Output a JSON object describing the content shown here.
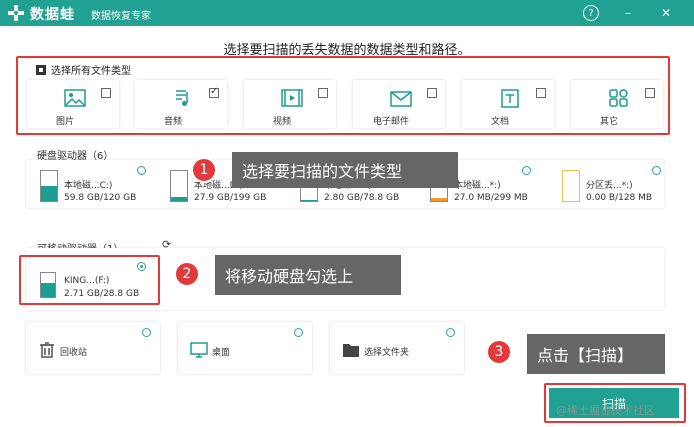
{
  "titlebar": {
    "app_name": "数据蛙",
    "subtitle": "数据恢复专家",
    "help": "?",
    "minimize": "–",
    "close": "✕"
  },
  "heading": "选择要扫描的丢失数据的数据类型和路径。",
  "file_types": {
    "select_all": "选择所有文件类型",
    "items": [
      {
        "label": "图片",
        "checked": false
      },
      {
        "label": "音频",
        "checked": true
      },
      {
        "label": "视频",
        "checked": false
      },
      {
        "label": "电子邮件",
        "checked": false
      },
      {
        "label": "文档",
        "checked": false
      },
      {
        "label": "其它",
        "checked": false
      }
    ]
  },
  "hard_drives": {
    "title": "硬盘驱动器（6）",
    "items": [
      {
        "name": "本地磁...C:)",
        "size": "59.8 GB/120 GB",
        "fill": 0.5
      },
      {
        "name": "本地磁...D:)",
        "size": "27.9 GB/199 GB",
        "fill": 0.14
      },
      {
        "name": "本地磁...E:)",
        "size": "2.80 GB/78.8 GB",
        "fill": 0.04
      },
      {
        "name": "本地磁...*:)",
        "size": "27.0 MB/299 MB",
        "fill": 0.09
      },
      {
        "name": "分区丢...*:)",
        "size": "0.00  B/128 MB",
        "fill": 0.0
      }
    ]
  },
  "removable": {
    "title": "可移动驱动器（1）",
    "drive": {
      "name": "KING...(F:)",
      "size": "2.71 GB/28.8 GB"
    }
  },
  "locations": [
    {
      "label": "回收站"
    },
    {
      "label": "桌面"
    },
    {
      "label": "选择文件夹"
    }
  ],
  "callouts": [
    {
      "num": "1",
      "text": "选择要扫描的文件类型"
    },
    {
      "num": "2",
      "text": "将移动硬盘勾选上"
    },
    {
      "num": "3",
      "text": "点击【扫描】"
    }
  ],
  "scan_button": "扫描",
  "watermark": "@稀土掘金技术社区",
  "colors": {
    "brand": "#21a192",
    "highlight": "#e23a3a",
    "callout_bg": "#666666"
  }
}
